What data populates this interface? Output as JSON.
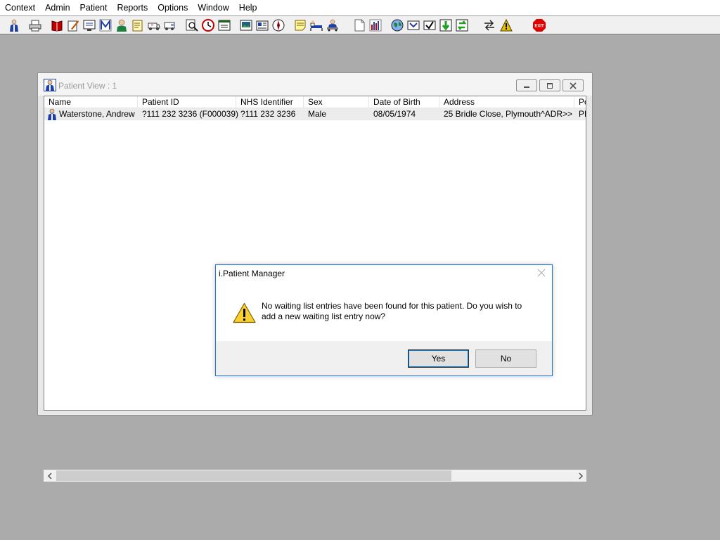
{
  "menu": [
    "Context",
    "Admin",
    "Patient",
    "Reports",
    "Options",
    "Window",
    "Help"
  ],
  "toolbar": {
    "buttons": [
      {
        "name": "patient-search-icon",
        "color": "#1f3fa8"
      },
      {
        "name": "printer-icon",
        "color": "#404040"
      },
      {
        "name": "book-icon",
        "color": "#c00000"
      },
      {
        "name": "chart-edit-icon",
        "color": "#c05000"
      },
      {
        "name": "monitor-list-icon",
        "color": "#2040a0"
      },
      {
        "name": "letter-m-icon",
        "color": "#1f3fa8"
      },
      {
        "name": "doctor-icon",
        "color": "#208040"
      },
      {
        "name": "notes-icon",
        "color": "#806000"
      },
      {
        "name": "ambulance-icon",
        "color": "#404040"
      },
      {
        "name": "transport-icon",
        "color": "#404040"
      },
      {
        "name": "find-record-icon",
        "color": "#404040"
      },
      {
        "name": "clock-icon",
        "color": "#c00000"
      },
      {
        "name": "list-window-icon",
        "color": "#206020"
      },
      {
        "name": "picture-icon",
        "color": "#206080"
      },
      {
        "name": "document-card-icon",
        "color": "#1f3fa8"
      },
      {
        "name": "compass-icon",
        "color": "#c00000"
      },
      {
        "name": "sticky-note-icon",
        "color": "#806000"
      },
      {
        "name": "bed-icon",
        "color": "#1f3fa8"
      },
      {
        "name": "patient-transfer-icon",
        "color": "#1f3fa8"
      },
      {
        "name": "blank-page-icon",
        "color": "#606060"
      },
      {
        "name": "bar-chart-icon",
        "color": "#c00000"
      },
      {
        "name": "globe-icon",
        "color": "#208040"
      },
      {
        "name": "inbox-icon",
        "color": "#1f3fa8"
      },
      {
        "name": "tray-check-icon",
        "color": "#606060"
      },
      {
        "name": "green-arrow-down-icon",
        "color": "#20a020"
      },
      {
        "name": "green-refresh-icon",
        "color": "#20a020"
      },
      {
        "name": "swap-arrows-icon",
        "color": "#202020"
      },
      {
        "name": "warning-icon",
        "color": "#e8c000"
      },
      {
        "name": "exit-icon",
        "color": "#e00000"
      }
    ],
    "exit_label": "EXIT"
  },
  "patient_view": {
    "title": "Patient View : 1",
    "columns": [
      "Name",
      "Patient ID",
      "NHS Identifier",
      "Sex",
      "Date of Birth",
      "Address",
      "Po"
    ],
    "rows": [
      {
        "name": "Waterstone, Andrew",
        "patient_id": "?111 232 3236 (F000039)",
        "nhs_identifier": "?111 232 3236",
        "sex": "Male",
        "dob": "08/05/1974",
        "address": "25 Bridle Close, Plymouth^ADR>>",
        "postcode": "PL"
      }
    ]
  },
  "dialog": {
    "title": "i.Patient Manager",
    "message": "No waiting list entries have been found for this patient. Do you wish to add a new waiting list entry now?",
    "yes_label": "Yes",
    "no_label": "No"
  },
  "colors": {
    "desktop": "#ababab",
    "dialog_border": "#1e7ad6",
    "selected_row": "#ececec"
  }
}
